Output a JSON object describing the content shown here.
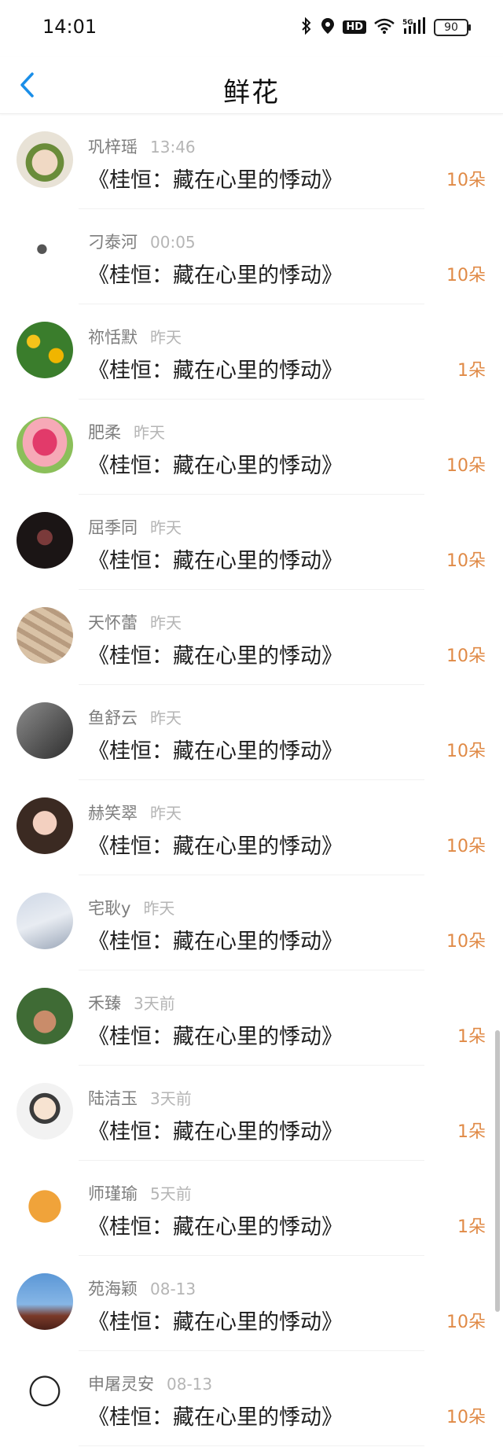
{
  "status": {
    "time": "14:01",
    "battery": "90"
  },
  "header": {
    "title": "鲜花"
  },
  "list": [
    {
      "name": "巩梓瑶",
      "time": "13:46",
      "book": "《桂恒：藏在心里的悸动》",
      "count": "10朵",
      "avatar": "portrait"
    },
    {
      "name": "刁泰河",
      "time": "00:05",
      "book": "《桂恒：藏在心里的悸动》",
      "count": "10朵",
      "avatar": "sketch"
    },
    {
      "name": "祢恬默",
      "time": "昨天",
      "book": "《桂恒：藏在心里的悸动》",
      "count": "1朵",
      "avatar": "sunflower"
    },
    {
      "name": "肥柔",
      "time": "昨天",
      "book": "《桂恒：藏在心里的悸动》",
      "count": "10朵",
      "avatar": "tulip"
    },
    {
      "name": "屈季同",
      "time": "昨天",
      "book": "《桂恒：藏在心里的悸动》",
      "count": "10朵",
      "avatar": "dark"
    },
    {
      "name": "天怀蕾",
      "time": "昨天",
      "book": "《桂恒：藏在心里的悸动》",
      "count": "10朵",
      "avatar": "money"
    },
    {
      "name": "鱼舒云",
      "time": "昨天",
      "book": "《桂恒：藏在心里的悸动》",
      "count": "10朵",
      "avatar": "gray"
    },
    {
      "name": "赫笑翠",
      "time": "昨天",
      "book": "《桂恒：藏在心里的悸动》",
      "count": "10朵",
      "avatar": "girl"
    },
    {
      "name": "宅耿y",
      "time": "昨天",
      "book": "《桂恒：藏在心里的悸动》",
      "count": "10朵",
      "avatar": "girl2"
    },
    {
      "name": "禾臻",
      "time": "3天前",
      "book": "《桂恒：藏在心里的悸动》",
      "count": "1朵",
      "avatar": "group"
    },
    {
      "name": "陆洁玉",
      "time": "3天前",
      "book": "《桂恒：藏在心里的悸动》",
      "count": "1朵",
      "avatar": "cartoon"
    },
    {
      "name": "师瑾瑜",
      "time": "5天前",
      "book": "《桂恒：藏在心里的悸动》",
      "count": "1朵",
      "avatar": "tiger"
    },
    {
      "name": "苑海颖",
      "time": "08-13",
      "book": "《桂恒：藏在心里的悸动》",
      "count": "10朵",
      "avatar": "sky"
    },
    {
      "name": "申屠灵安",
      "time": "08-13",
      "book": "《桂恒：藏在心里的悸动》",
      "count": "10朵",
      "avatar": "meme"
    }
  ],
  "colors": {
    "accent": "#e08a46",
    "back_arrow": "#1a8ee8"
  }
}
